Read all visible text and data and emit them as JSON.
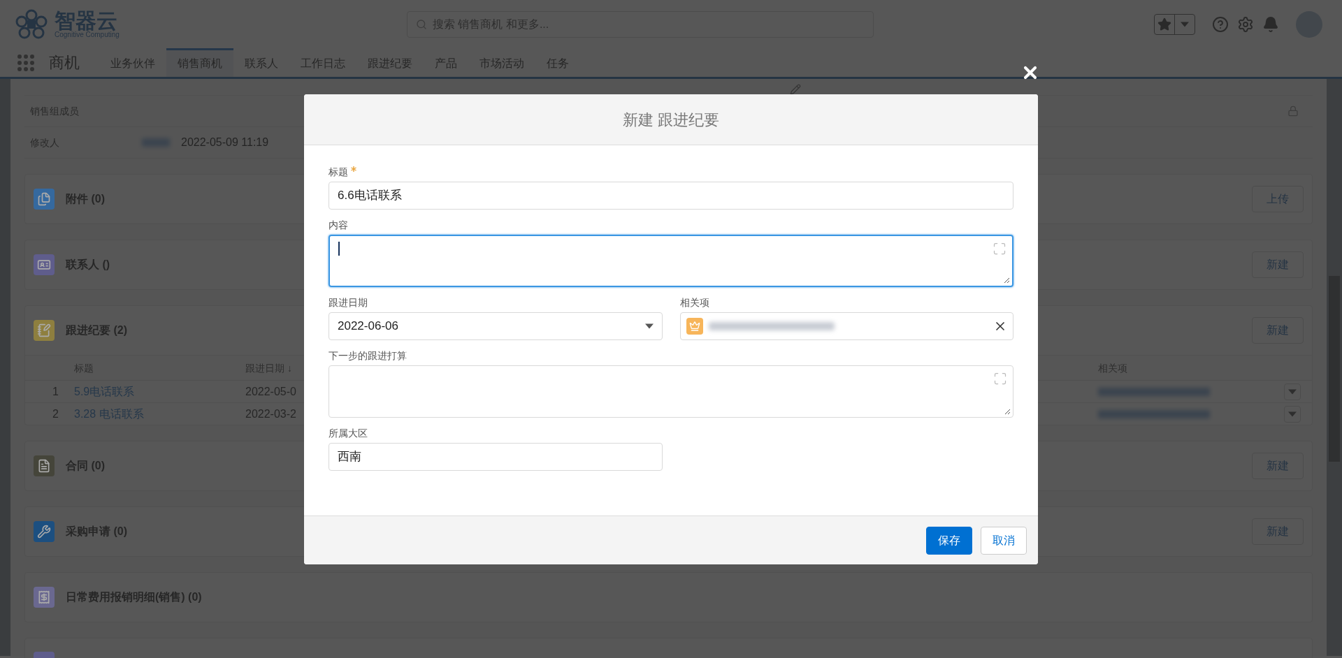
{
  "header": {
    "logo": {
      "name": "智器云",
      "tagline": "Cognitive Computing"
    },
    "search": {
      "placeholder": "搜索 销售商机 和更多..."
    }
  },
  "nav": {
    "app_name": "商机",
    "tabs": [
      {
        "label": "业务伙伴",
        "selected": false
      },
      {
        "label": "销售商机",
        "selected": true
      },
      {
        "label": "联系人",
        "selected": false
      },
      {
        "label": "工作日志",
        "selected": false
      },
      {
        "label": "跟进纪要",
        "selected": false
      },
      {
        "label": "产品",
        "selected": false
      },
      {
        "label": "市场活动",
        "selected": false
      },
      {
        "label": "任务",
        "selected": false
      }
    ]
  },
  "record_fields": [
    {
      "label": "销售组成员",
      "locked": true
    },
    {
      "label": "修改人",
      "value": "2022-05-09 11:19"
    }
  ],
  "related_lists": [
    {
      "title": "附件 (0)",
      "button": "上传",
      "color": "#35699f"
    },
    {
      "title": "联系人 ()",
      "button": "新建",
      "color": "#5f5d8c"
    },
    {
      "title": "跟进纪要 (2)",
      "button": "新建",
      "color": "#8e7f3f",
      "table": {
        "columns": [
          "标题",
          "跟进日期 ↓",
          "相关项"
        ],
        "rows": [
          {
            "index": "1",
            "title": "5.9电话联系",
            "date": "2022-05-0"
          },
          {
            "index": "2",
            "title": "3.28 电话联系",
            "date": "2022-03-2"
          }
        ]
      }
    },
    {
      "title": "合同 (0)",
      "button": "新建",
      "color": "#45453a"
    },
    {
      "title": "采购申请 (0)",
      "button": "新建",
      "color": "#1c4f80"
    },
    {
      "title": "日常费用报销明细(销售) (0)",
      "color": "#6a6890"
    }
  ],
  "modal": {
    "title": "新建 跟进纪要",
    "fields": [
      {
        "kind": "text",
        "label": "标题",
        "required": true,
        "value": "6.6电话联系"
      },
      {
        "kind": "textarea",
        "label": "内容",
        "focused": true
      },
      {
        "kind": "date",
        "label": "跟进日期",
        "value": "2022-06-06"
      },
      {
        "kind": "lookup",
        "label": "相关项"
      },
      {
        "kind": "textarea",
        "label": "下一步的跟进打算",
        "focused": false
      },
      {
        "kind": "text",
        "label": "所属大区",
        "value": "西南"
      }
    ],
    "buttons": [
      {
        "label": "保存",
        "primary": true
      },
      {
        "label": "取消",
        "primary": false
      }
    ]
  }
}
